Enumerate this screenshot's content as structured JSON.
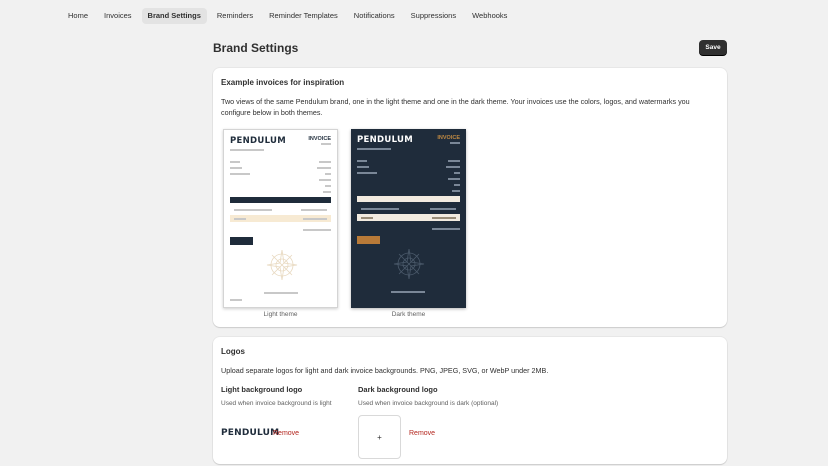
{
  "nav": {
    "tabs": [
      "Home",
      "Invoices",
      "Brand Settings",
      "Reminders",
      "Reminder Templates",
      "Notifications",
      "Suppressions",
      "Webhooks"
    ],
    "active": "Brand Settings"
  },
  "page": {
    "title": "Brand Settings",
    "save_label": "Save"
  },
  "examples": {
    "title": "Example invoices for inspiration",
    "description": "Two views of the same Pendulum brand, one in the light theme and one in the dark theme. Your invoices use the colors, logos, and watermarks you configure below in both themes.",
    "invoice_brand": "PENDULUM",
    "invoice_title": "INVOICE",
    "light_caption": "Light theme",
    "dark_caption": "Dark theme"
  },
  "logos": {
    "title": "Logos",
    "description": "Upload separate logos for light and dark invoice backgrounds. PNG, JPEG, SVG, or WebP under 2MB.",
    "light_title": "Light background logo",
    "light_hint": "Used when invoice background is light",
    "light_preview": "PENDULUM",
    "dark_title": "Dark background logo",
    "dark_hint": "Used when invoice background is dark (optional)",
    "dark_placeholder": "+",
    "remove_label": "Remove"
  },
  "colors": {
    "navy": "#1f2c3b",
    "gold": "#c08a43",
    "cream": "#f7ead3",
    "danger": "#b3261e"
  }
}
